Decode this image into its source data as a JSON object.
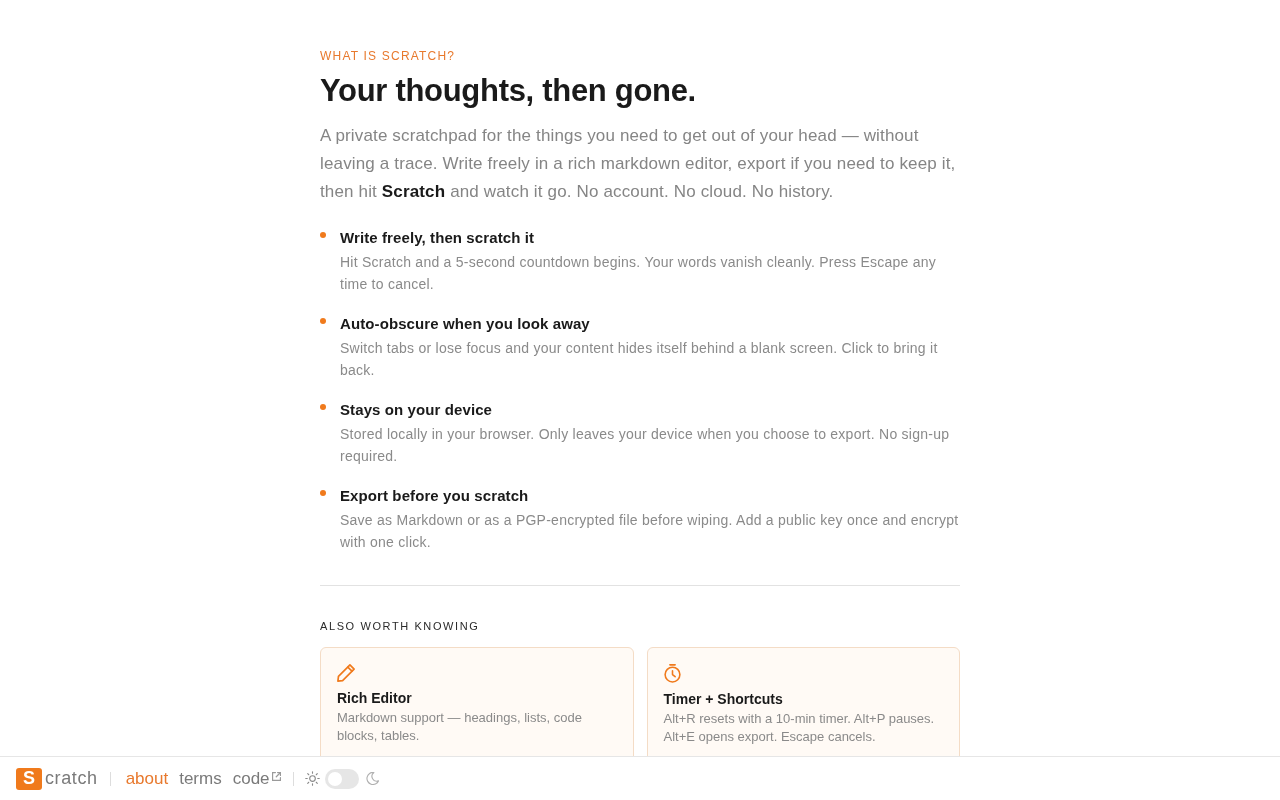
{
  "intro": {
    "eyebrow": "WHAT IS SCRATCH?",
    "title": "Your thoughts, then gone.",
    "description": "A private scratchpad for the things you need to get out of your head — without leaving a trace. Write freely in a rich markdown editor, export if you need to keep it, then hit **Scratch** and watch it go. No account. No cloud. No history."
  },
  "features": [
    {
      "title": "Write freely, then scratch it",
      "description": "Hit Scratch and a 5-second countdown begins. Your words vanish cleanly. Press Escape any time to cancel."
    },
    {
      "title": "Auto-obscure when you look away",
      "description": "Switch tabs or lose focus and your content hides itself behind a blank screen. Click to bring it back."
    },
    {
      "title": "Stays on your device",
      "description": "Stored locally in your browser. Only leaves your device when you choose to export. No sign-up required."
    },
    {
      "title": "Export before you scratch",
      "description": "Save as Markdown or as a PGP-encrypted file before wiping. Add a public key once and encrypt with one click."
    }
  ],
  "also": {
    "heading": "ALSO WORTH KNOWING",
    "cards": [
      {
        "kind": "editor",
        "title": "Rich Editor",
        "description": "Markdown support — headings, lists, code blocks, tables."
      },
      {
        "kind": "timer",
        "title": "Timer + Shortcuts",
        "description": "Alt+R resets with a 10-min timer. Alt+P pauses. Alt+E opens export. Escape cancels."
      }
    ]
  },
  "footer": {
    "logo": {
      "mark": "S",
      "text": "cratch"
    },
    "links": [
      {
        "label": "about",
        "selected": true,
        "external": false
      },
      {
        "label": "terms",
        "selected": false,
        "external": false
      },
      {
        "label": "code",
        "selected": false,
        "external": true
      }
    ],
    "theme_toggle": {
      "on": false
    }
  }
}
